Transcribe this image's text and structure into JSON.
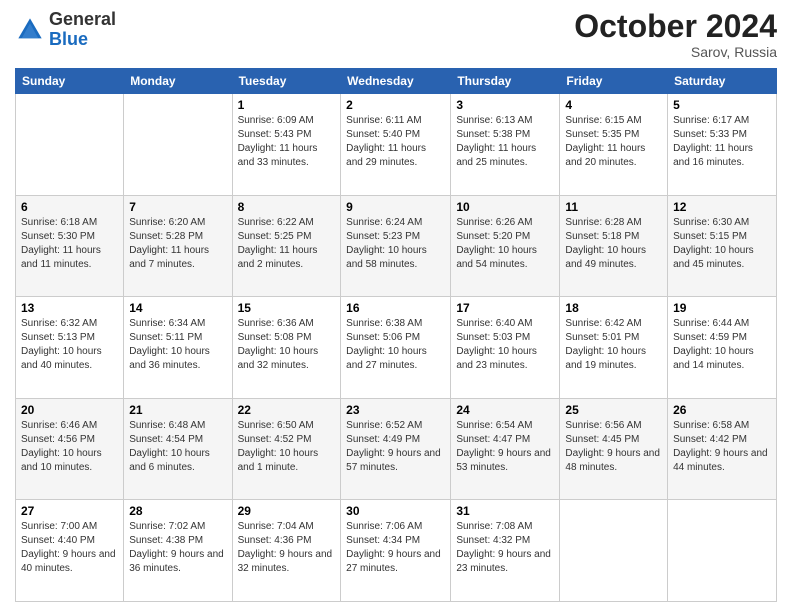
{
  "header": {
    "logo_general": "General",
    "logo_blue": "Blue",
    "month_title": "October 2024",
    "subtitle": "Sarov, Russia"
  },
  "days_of_week": [
    "Sunday",
    "Monday",
    "Tuesday",
    "Wednesday",
    "Thursday",
    "Friday",
    "Saturday"
  ],
  "weeks": [
    [
      {
        "day": "",
        "sunrise": "",
        "sunset": "",
        "daylight": ""
      },
      {
        "day": "",
        "sunrise": "",
        "sunset": "",
        "daylight": ""
      },
      {
        "day": "1",
        "sunrise": "Sunrise: 6:09 AM",
        "sunset": "Sunset: 5:43 PM",
        "daylight": "Daylight: 11 hours and 33 minutes."
      },
      {
        "day": "2",
        "sunrise": "Sunrise: 6:11 AM",
        "sunset": "Sunset: 5:40 PM",
        "daylight": "Daylight: 11 hours and 29 minutes."
      },
      {
        "day": "3",
        "sunrise": "Sunrise: 6:13 AM",
        "sunset": "Sunset: 5:38 PM",
        "daylight": "Daylight: 11 hours and 25 minutes."
      },
      {
        "day": "4",
        "sunrise": "Sunrise: 6:15 AM",
        "sunset": "Sunset: 5:35 PM",
        "daylight": "Daylight: 11 hours and 20 minutes."
      },
      {
        "day": "5",
        "sunrise": "Sunrise: 6:17 AM",
        "sunset": "Sunset: 5:33 PM",
        "daylight": "Daylight: 11 hours and 16 minutes."
      }
    ],
    [
      {
        "day": "6",
        "sunrise": "Sunrise: 6:18 AM",
        "sunset": "Sunset: 5:30 PM",
        "daylight": "Daylight: 11 hours and 11 minutes."
      },
      {
        "day": "7",
        "sunrise": "Sunrise: 6:20 AM",
        "sunset": "Sunset: 5:28 PM",
        "daylight": "Daylight: 11 hours and 7 minutes."
      },
      {
        "day": "8",
        "sunrise": "Sunrise: 6:22 AM",
        "sunset": "Sunset: 5:25 PM",
        "daylight": "Daylight: 11 hours and 2 minutes."
      },
      {
        "day": "9",
        "sunrise": "Sunrise: 6:24 AM",
        "sunset": "Sunset: 5:23 PM",
        "daylight": "Daylight: 10 hours and 58 minutes."
      },
      {
        "day": "10",
        "sunrise": "Sunrise: 6:26 AM",
        "sunset": "Sunset: 5:20 PM",
        "daylight": "Daylight: 10 hours and 54 minutes."
      },
      {
        "day": "11",
        "sunrise": "Sunrise: 6:28 AM",
        "sunset": "Sunset: 5:18 PM",
        "daylight": "Daylight: 10 hours and 49 minutes."
      },
      {
        "day": "12",
        "sunrise": "Sunrise: 6:30 AM",
        "sunset": "Sunset: 5:15 PM",
        "daylight": "Daylight: 10 hours and 45 minutes."
      }
    ],
    [
      {
        "day": "13",
        "sunrise": "Sunrise: 6:32 AM",
        "sunset": "Sunset: 5:13 PM",
        "daylight": "Daylight: 10 hours and 40 minutes."
      },
      {
        "day": "14",
        "sunrise": "Sunrise: 6:34 AM",
        "sunset": "Sunset: 5:11 PM",
        "daylight": "Daylight: 10 hours and 36 minutes."
      },
      {
        "day": "15",
        "sunrise": "Sunrise: 6:36 AM",
        "sunset": "Sunset: 5:08 PM",
        "daylight": "Daylight: 10 hours and 32 minutes."
      },
      {
        "day": "16",
        "sunrise": "Sunrise: 6:38 AM",
        "sunset": "Sunset: 5:06 PM",
        "daylight": "Daylight: 10 hours and 27 minutes."
      },
      {
        "day": "17",
        "sunrise": "Sunrise: 6:40 AM",
        "sunset": "Sunset: 5:03 PM",
        "daylight": "Daylight: 10 hours and 23 minutes."
      },
      {
        "day": "18",
        "sunrise": "Sunrise: 6:42 AM",
        "sunset": "Sunset: 5:01 PM",
        "daylight": "Daylight: 10 hours and 19 minutes."
      },
      {
        "day": "19",
        "sunrise": "Sunrise: 6:44 AM",
        "sunset": "Sunset: 4:59 PM",
        "daylight": "Daylight: 10 hours and 14 minutes."
      }
    ],
    [
      {
        "day": "20",
        "sunrise": "Sunrise: 6:46 AM",
        "sunset": "Sunset: 4:56 PM",
        "daylight": "Daylight: 10 hours and 10 minutes."
      },
      {
        "day": "21",
        "sunrise": "Sunrise: 6:48 AM",
        "sunset": "Sunset: 4:54 PM",
        "daylight": "Daylight: 10 hours and 6 minutes."
      },
      {
        "day": "22",
        "sunrise": "Sunrise: 6:50 AM",
        "sunset": "Sunset: 4:52 PM",
        "daylight": "Daylight: 10 hours and 1 minute."
      },
      {
        "day": "23",
        "sunrise": "Sunrise: 6:52 AM",
        "sunset": "Sunset: 4:49 PM",
        "daylight": "Daylight: 9 hours and 57 minutes."
      },
      {
        "day": "24",
        "sunrise": "Sunrise: 6:54 AM",
        "sunset": "Sunset: 4:47 PM",
        "daylight": "Daylight: 9 hours and 53 minutes."
      },
      {
        "day": "25",
        "sunrise": "Sunrise: 6:56 AM",
        "sunset": "Sunset: 4:45 PM",
        "daylight": "Daylight: 9 hours and 48 minutes."
      },
      {
        "day": "26",
        "sunrise": "Sunrise: 6:58 AM",
        "sunset": "Sunset: 4:42 PM",
        "daylight": "Daylight: 9 hours and 44 minutes."
      }
    ],
    [
      {
        "day": "27",
        "sunrise": "Sunrise: 7:00 AM",
        "sunset": "Sunset: 4:40 PM",
        "daylight": "Daylight: 9 hours and 40 minutes."
      },
      {
        "day": "28",
        "sunrise": "Sunrise: 7:02 AM",
        "sunset": "Sunset: 4:38 PM",
        "daylight": "Daylight: 9 hours and 36 minutes."
      },
      {
        "day": "29",
        "sunrise": "Sunrise: 7:04 AM",
        "sunset": "Sunset: 4:36 PM",
        "daylight": "Daylight: 9 hours and 32 minutes."
      },
      {
        "day": "30",
        "sunrise": "Sunrise: 7:06 AM",
        "sunset": "Sunset: 4:34 PM",
        "daylight": "Daylight: 9 hours and 27 minutes."
      },
      {
        "day": "31",
        "sunrise": "Sunrise: 7:08 AM",
        "sunset": "Sunset: 4:32 PM",
        "daylight": "Daylight: 9 hours and 23 minutes."
      },
      {
        "day": "",
        "sunrise": "",
        "sunset": "",
        "daylight": ""
      },
      {
        "day": "",
        "sunrise": "",
        "sunset": "",
        "daylight": ""
      }
    ]
  ]
}
